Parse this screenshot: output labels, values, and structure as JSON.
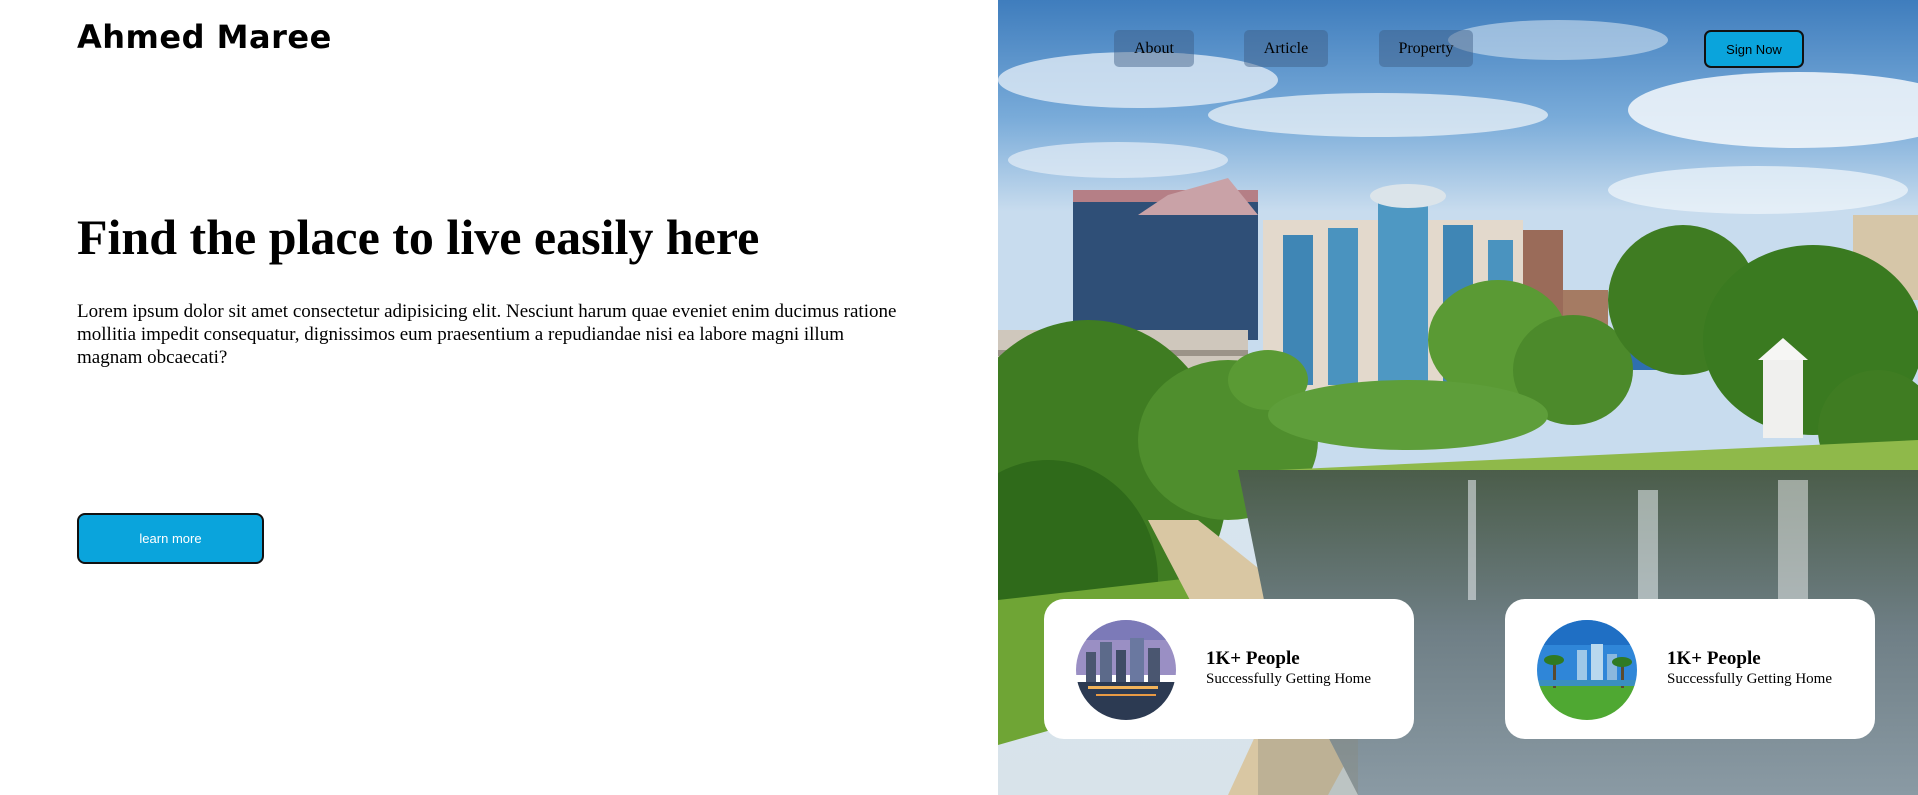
{
  "brand": {
    "name": "Ahmed Maree"
  },
  "hero": {
    "headline": "Find the place to live easily here",
    "description": "Lorem ipsum dolor sit amet consectetur adipisicing elit. Nesciunt harum quae eveniet enim ducimus ratione mollitia impedit consequatur, dignissimos eum praesentium a repudiandae nisi ea labore magni illum magnam obcaecati?",
    "cta_label": "learn more",
    "accent_color": "#0aa4dc"
  },
  "nav": {
    "links": [
      {
        "label": "About"
      },
      {
        "label": "Article"
      },
      {
        "label": "Property"
      }
    ],
    "signup_label": "Sign Now"
  },
  "stats": [
    {
      "number": "1K+ People",
      "caption": "Successfully Getting Home",
      "thumb": "city-at-dusk"
    },
    {
      "number": "1K+ People",
      "caption": "Successfully Getting Home",
      "thumb": "palm-skyline"
    }
  ]
}
